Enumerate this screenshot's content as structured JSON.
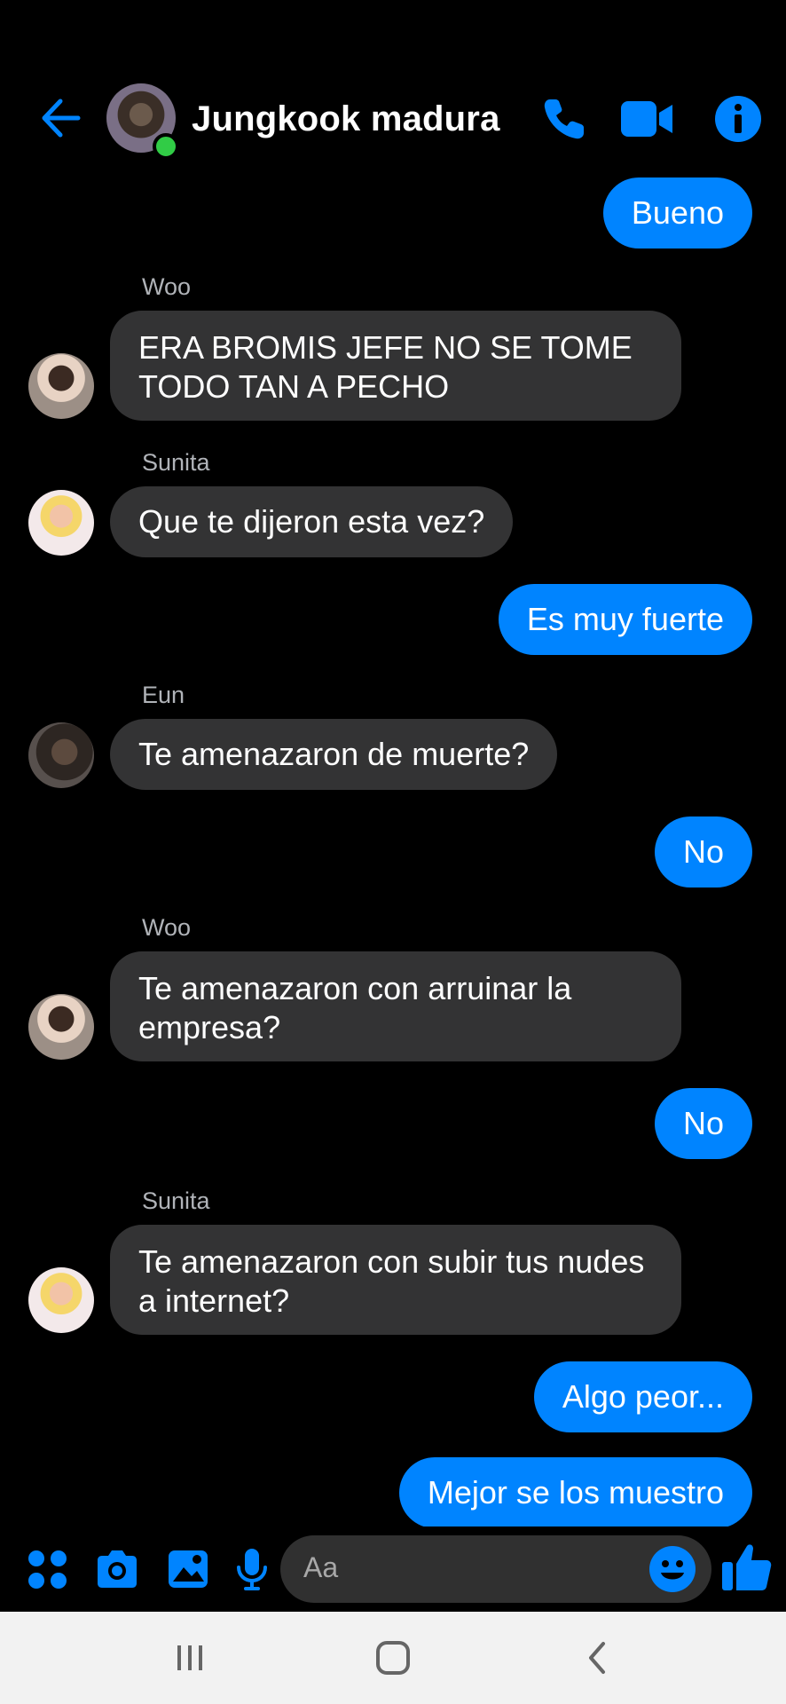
{
  "header": {
    "title": "Jungkook madura",
    "back_icon": "arrow-left-icon",
    "call_icon": "phone-icon",
    "video_icon": "video-camera-icon",
    "info_icon": "info-icon",
    "accent": "#0084ff",
    "online_color": "#31cc46"
  },
  "messages": [
    {
      "from": "me",
      "text": "Bueno"
    },
    {
      "from": "them",
      "sender": "Woo",
      "text": "ERA BROMIS JEFE NO SE TOME TODO TAN A PECHO"
    },
    {
      "from": "them",
      "sender": "Sunita",
      "text": "Que te dijeron esta vez?"
    },
    {
      "from": "me",
      "text": "Es muy fuerte"
    },
    {
      "from": "them",
      "sender": "Eun",
      "text": "Te amenazaron de muerte?"
    },
    {
      "from": "me",
      "text": "No"
    },
    {
      "from": "them",
      "sender": "Woo",
      "text": "Te amenazaron con arruinar la empresa?"
    },
    {
      "from": "me",
      "text": "No"
    },
    {
      "from": "them",
      "sender": "Sunita",
      "text": "Te amenazaron con subir tus nudes a internet?"
    },
    {
      "from": "me",
      "text": "Algo peor..."
    },
    {
      "from": "me",
      "text": "Mejor se los muestro"
    }
  ],
  "composer": {
    "placeholder": "Aa",
    "icons": [
      "apps-grid-icon",
      "camera-icon",
      "gallery-icon",
      "microphone-icon",
      "emoji-icon",
      "thumbs-up-icon"
    ]
  },
  "navbar": {
    "icons": [
      "recent-apps-icon",
      "home-icon",
      "back-icon"
    ]
  },
  "colors": {
    "my_bubble": "#0084ff",
    "their_bubble": "#333334",
    "background": "#000000"
  }
}
